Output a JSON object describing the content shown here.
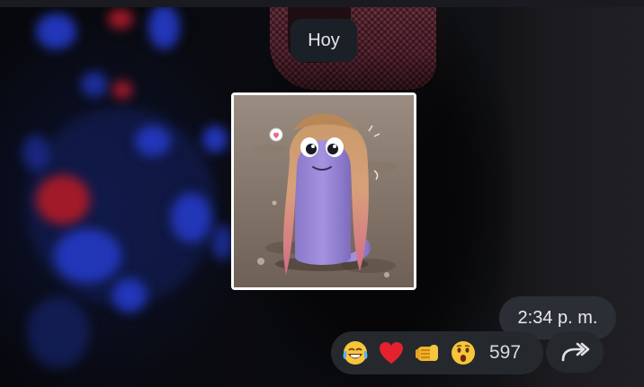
{
  "chat": {
    "date_separator": "Hoy",
    "message": {
      "type": "sticker",
      "sticker_icon": "hair-worm-sticker",
      "time": "2:34 p. m.",
      "reactions": [
        {
          "icon": "tears-of-joy-emoji"
        },
        {
          "icon": "red-heart-emoji"
        },
        {
          "icon": "oncoming-fist-emoji"
        },
        {
          "icon": "astonished-face-emoji"
        }
      ],
      "reaction_count": "597",
      "forward_icon": "forward-arrow-icon"
    }
  },
  "colors": {
    "pill_bg": "#1b2026",
    "reaction_bg": "#25292e",
    "time_bg": "#2b2f35",
    "text": "#e6e8ea"
  }
}
